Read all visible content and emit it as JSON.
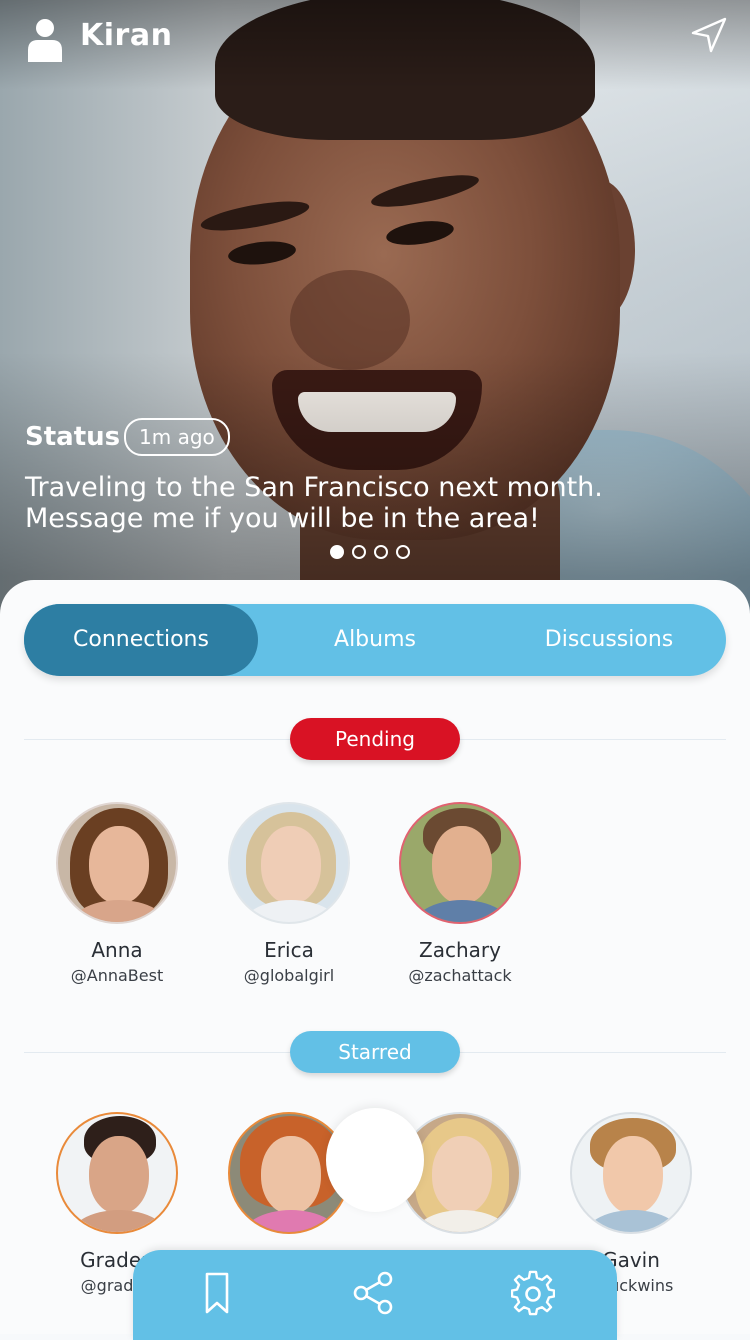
{
  "header": {
    "user_name": "Kiran"
  },
  "status": {
    "title": "Status",
    "time_badge": "1m ago",
    "text_line1": "Traveling to the San Francisco next month.",
    "text_line2": "Message me if you will be in the area!",
    "carousel_pages": 4,
    "carousel_active_index": 0
  },
  "tabs": [
    {
      "label": "Connections",
      "active": true
    },
    {
      "label": "Albums",
      "active": false
    },
    {
      "label": "Discussions",
      "active": false
    }
  ],
  "pending": {
    "label": "Pending",
    "people": [
      {
        "name": "Anna",
        "handle": "@AnnaBest"
      },
      {
        "name": "Erica",
        "handle": "@globalgirl"
      },
      {
        "name": "Zachary",
        "handle": "@zachattack"
      }
    ]
  },
  "starred": {
    "label": "Starred",
    "people": [
      {
        "name": "Graden",
        "handle": "@graden"
      },
      {
        "name": "",
        "handle": ""
      },
      {
        "name": "",
        "handle": ""
      },
      {
        "name": "Gavin",
        "handle": "@luckwins"
      }
    ]
  },
  "bottom_nav": [
    {
      "icon": "bookmark-icon"
    },
    {
      "icon": "share-icon"
    },
    {
      "icon": "gear-icon"
    }
  ],
  "colors": {
    "accent": "#62c0e6",
    "accent_dark": "#2d7ea3",
    "pending_red": "#d91224"
  }
}
